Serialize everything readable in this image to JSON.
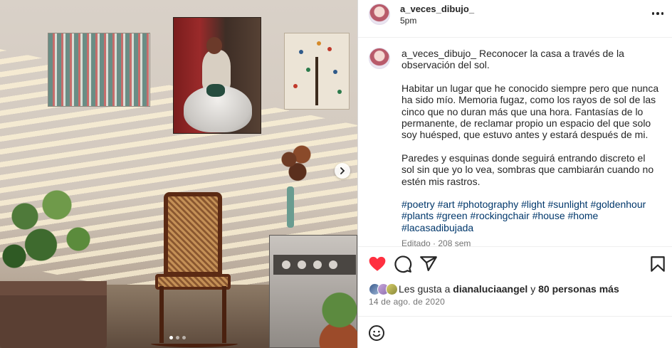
{
  "post": {
    "author": "a_veces_dibujo_",
    "time_ago": "5pm",
    "caption": {
      "author": "a_veces_dibujo_",
      "line1": "Reconocer la casa a través de la observación del sol.",
      "para2": "Habitar un lugar que he conocido siempre pero que nunca ha sido mío. Memoria fugaz, como los rayos de sol de las cinco que no duran más que una hora. Fantasías de lo permanente, de reclamar propio un espacio del que solo soy huésped, que estuvo antes y estará después de mi.",
      "para3": "Paredes y esquinas donde seguirá entrando discreto el sol sin que yo lo vea, sombras que cambiarán cuando no estén mis rastros.",
      "hashtags": [
        "#poetry",
        "#art",
        "#photography",
        "#light",
        "#sunlight",
        "#goldenhour",
        "#plants",
        "#green",
        "#rockingchair",
        "#house",
        "#home",
        "#lacasadibujada"
      ]
    },
    "edited_label": "Editado · 208 sem",
    "likes": {
      "prefix": "Les gusta a",
      "user": "dianaluciaangel",
      "connector": "y",
      "others": "80 personas más"
    },
    "date": "14 de ago. de 2020",
    "carousel": {
      "slides": 3,
      "active_index": 0
    }
  },
  "icons": {
    "like": "heart-filled-icon",
    "comment": "comment-bubble-icon",
    "share": "paper-plane-icon",
    "save": "bookmark-icon",
    "more": "more-horizontal-icon",
    "next": "chevron-right-icon",
    "emoji": "emoji-smile-icon"
  },
  "colors": {
    "like_red": "#ff3040",
    "hashtag_blue": "#00376b",
    "meta_gray": "#737373",
    "text": "#262626"
  }
}
